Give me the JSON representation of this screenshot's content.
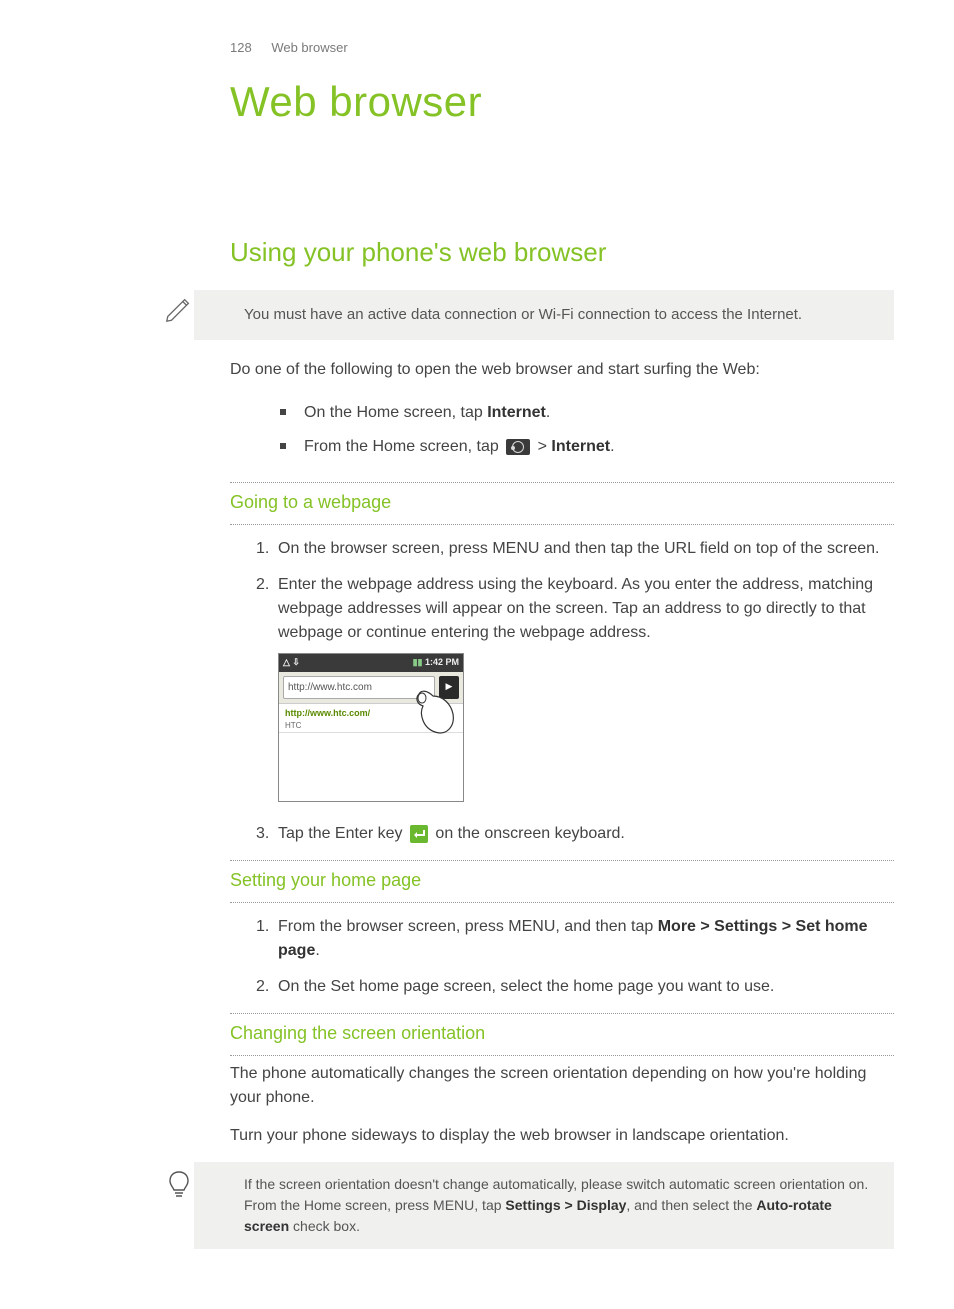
{
  "header": {
    "page_number": "128",
    "running_title": "Web browser"
  },
  "title": "Web browser",
  "section_title": "Using your phone's web browser",
  "note1": "You must have an active data connection or Wi-Fi connection to access the Internet.",
  "intro": "Do one of the following to open the web browser and start surfing the Web:",
  "bullet1_a": "On the Home screen, tap ",
  "bullet1_b": "Internet",
  "bullet1_c": ".",
  "bullet2_a": "From the Home screen, tap ",
  "bullet2_b": " > ",
  "bullet2_c": "Internet",
  "bullet2_d": ".",
  "sub1": "Going to a webpage",
  "s1_step1": "On the browser screen, press MENU and then tap the URL field on top of the screen.",
  "s1_step2": "Enter the webpage address using the keyboard. As you enter the address, matching webpage addresses will appear on the screen. Tap an address to go directly to that webpage or continue entering the webpage address.",
  "s1_step3_a": "Tap the Enter key ",
  "s1_step3_b": " on the onscreen keyboard.",
  "phone": {
    "status_left": "△ ⇩",
    "status_right": "1:42 PM",
    "url_value": "http://www.htc.com",
    "suggest_url": "http://www.htc.com/",
    "suggest_label": "HTC"
  },
  "sub2": "Setting your home page",
  "s2_step1_a": "From the browser screen, press MENU, and then tap ",
  "s2_step1_b": "More > Settings > Set home page",
  "s2_step1_c": ".",
  "s2_step2": "On the Set home page screen, select the home page you want to use.",
  "sub3": "Changing the screen orientation",
  "s3_p1": "The phone automatically changes the screen orientation depending on how you're holding your phone.",
  "s3_p2": "Turn your phone sideways to display the web browser in landscape orientation.",
  "tip_a": "If the screen orientation doesn't change automatically, please switch automatic screen orientation on. From the Home screen, press MENU, tap ",
  "tip_b": "Settings > Display",
  "tip_c": ", and then select the ",
  "tip_d": "Auto-rotate screen",
  "tip_e": " check box."
}
